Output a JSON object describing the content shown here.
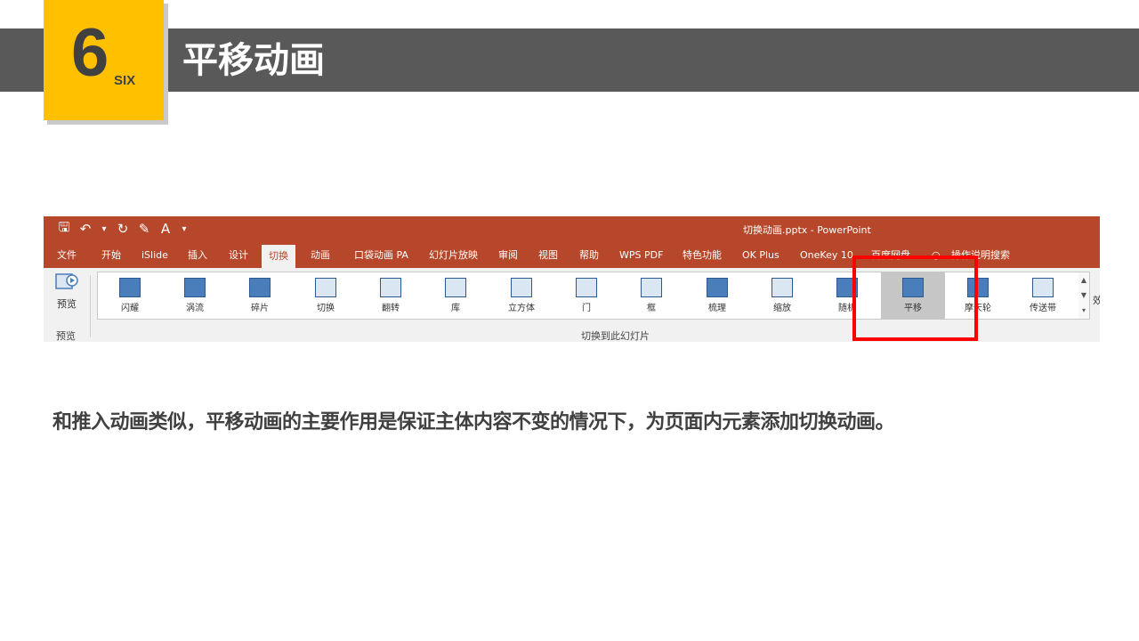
{
  "section": {
    "number": "6",
    "number_word": "SIX",
    "title": "平移动画"
  },
  "colors": {
    "accent": "#ffc000",
    "band": "#595959",
    "ppt_brand": "#b7472a",
    "highlight": "#ff0000",
    "text": "#404040"
  },
  "ppt": {
    "window_title": "切换动画.pptx  -  PowerPoint",
    "qat_icons": [
      "save-icon",
      "undo-icon",
      "redo-icon",
      "paint-icon",
      "text-icon",
      "customize-icon"
    ],
    "tabs": [
      {
        "label": "文件"
      },
      {
        "label": "开始"
      },
      {
        "label": "iSlide"
      },
      {
        "label": "插入"
      },
      {
        "label": "设计"
      },
      {
        "label": "切换",
        "active": true
      },
      {
        "label": "动画"
      },
      {
        "label": "口袋动画 PA"
      },
      {
        "label": "幻灯片放映"
      },
      {
        "label": "审阅"
      },
      {
        "label": "视图"
      },
      {
        "label": "帮助"
      },
      {
        "label": "WPS PDF"
      },
      {
        "label": "特色功能"
      },
      {
        "label": "OK Plus"
      },
      {
        "label": "OneKey 10"
      },
      {
        "label": "百度网盘"
      },
      {
        "label": "操作说明搜索"
      }
    ],
    "preview": {
      "button_label": "预览",
      "group_label": "预览"
    },
    "transitions": [
      {
        "label": "闪耀"
      },
      {
        "label": "涡流"
      },
      {
        "label": "碎片"
      },
      {
        "label": "切换"
      },
      {
        "label": "翻转"
      },
      {
        "label": "库"
      },
      {
        "label": "立方体"
      },
      {
        "label": "门"
      },
      {
        "label": "框"
      },
      {
        "label": "梳理"
      },
      {
        "label": "缩放"
      },
      {
        "label": "随机"
      },
      {
        "label": "平移",
        "selected": true
      },
      {
        "label": "摩天轮"
      },
      {
        "label": "传送带"
      }
    ],
    "gallery_group_label": "切换到此幻灯片",
    "effect_clip": "效"
  },
  "body_text": "和推入动画类似，平移动画的主要作用是保证主体内容不变的情况下，为页面内元素添加切换动画。"
}
